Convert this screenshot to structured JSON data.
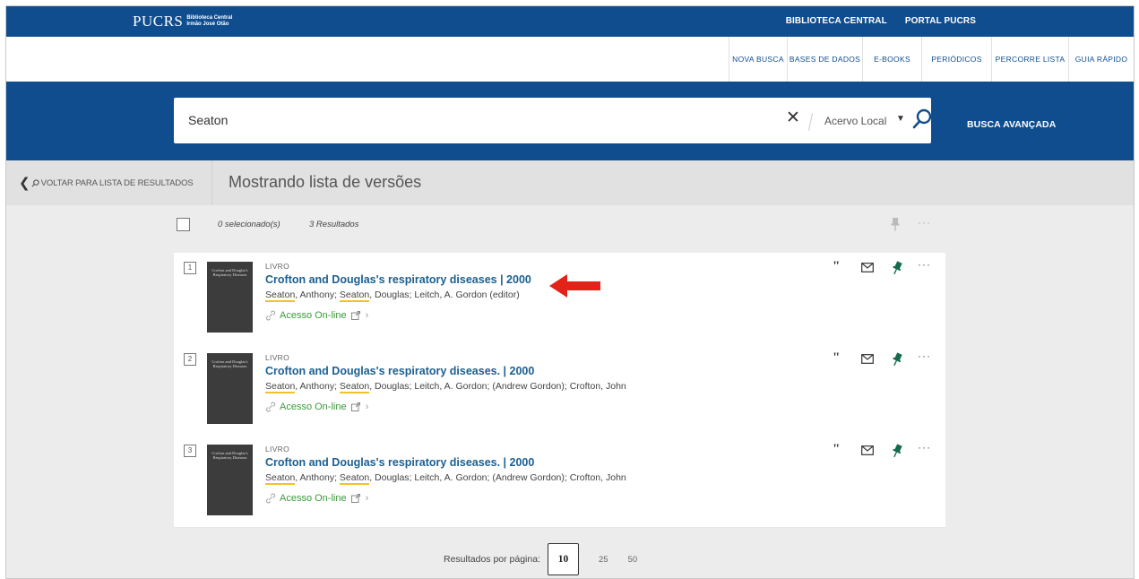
{
  "topbar": {
    "logo": "PUCRS",
    "logo_sub_1": "Biblioteca Central",
    "logo_sub_2": "Irmão José Otão",
    "links": [
      "BIBLIOTECA CENTRAL",
      "PORTAL PUCRS"
    ]
  },
  "nav": {
    "items": [
      "NOVA BUSCA",
      "BASES DE DADOS",
      "E-BOOKS",
      "PERIÓDICOS",
      "PERCORRE LISTA",
      "GUIA RÁPIDO"
    ]
  },
  "search": {
    "value": "Seaton",
    "clear_glyph": "✕",
    "scope": "Acervo Local",
    "advanced": "BUSCA AVANÇADA"
  },
  "backbar": {
    "back_label": "VOLTAR PARA LISTA DE RESULTADOS",
    "title": "Mostrando lista de versões"
  },
  "selection": {
    "selected": "0 selecionado(s)",
    "count": "3 Resultados"
  },
  "results": [
    {
      "index": "1",
      "type": "LIVRO",
      "title": "Crofton and Douglas's respiratory diseases | 2000",
      "authors_prefix": "",
      "author1": "Seaton",
      "author1_rest": ", Anthony; ",
      "author2": "Seaton",
      "author2_rest": ", Douglas; Leitch, A. Gordon (editor)",
      "access": "Acesso On-line",
      "cover_title": "Crofton and Douglas's Respiratory Diseases"
    },
    {
      "index": "2",
      "type": "LIVRO",
      "title": "Crofton and Douglas's respiratory diseases. | 2000",
      "author1": "Seaton",
      "author1_rest": ", Anthony; ",
      "author2": "Seaton",
      "author2_rest": ", Douglas; Leitch, A. Gordon; (Andrew Gordon); Crofton, John",
      "access": "Acesso On-line",
      "cover_title": "Crofton and Douglas's Respiratory Diseases"
    },
    {
      "index": "3",
      "type": "LIVRO",
      "title": "Crofton and Douglas's respiratory diseases. | 2000",
      "author1": "Seaton",
      "author1_rest": ", Anthony; ",
      "author2": "Seaton",
      "author2_rest": ", Douglas; Leitch, A. Gordon; (Andrew Gordon); Crofton, John",
      "access": "Acesso On-line",
      "cover_title": "Crofton and Douglas's Respiratory Diseases"
    }
  ],
  "pager": {
    "label": "Resultados por página:",
    "selected": "10",
    "options": [
      "25",
      "50"
    ]
  },
  "colors": {
    "brand_blue": "#0f4d8f",
    "link_blue": "#1c5f90",
    "access_green": "#3c9a3c",
    "highlight_yellow": "#f2c12e",
    "annotation_red": "#e2231a"
  }
}
